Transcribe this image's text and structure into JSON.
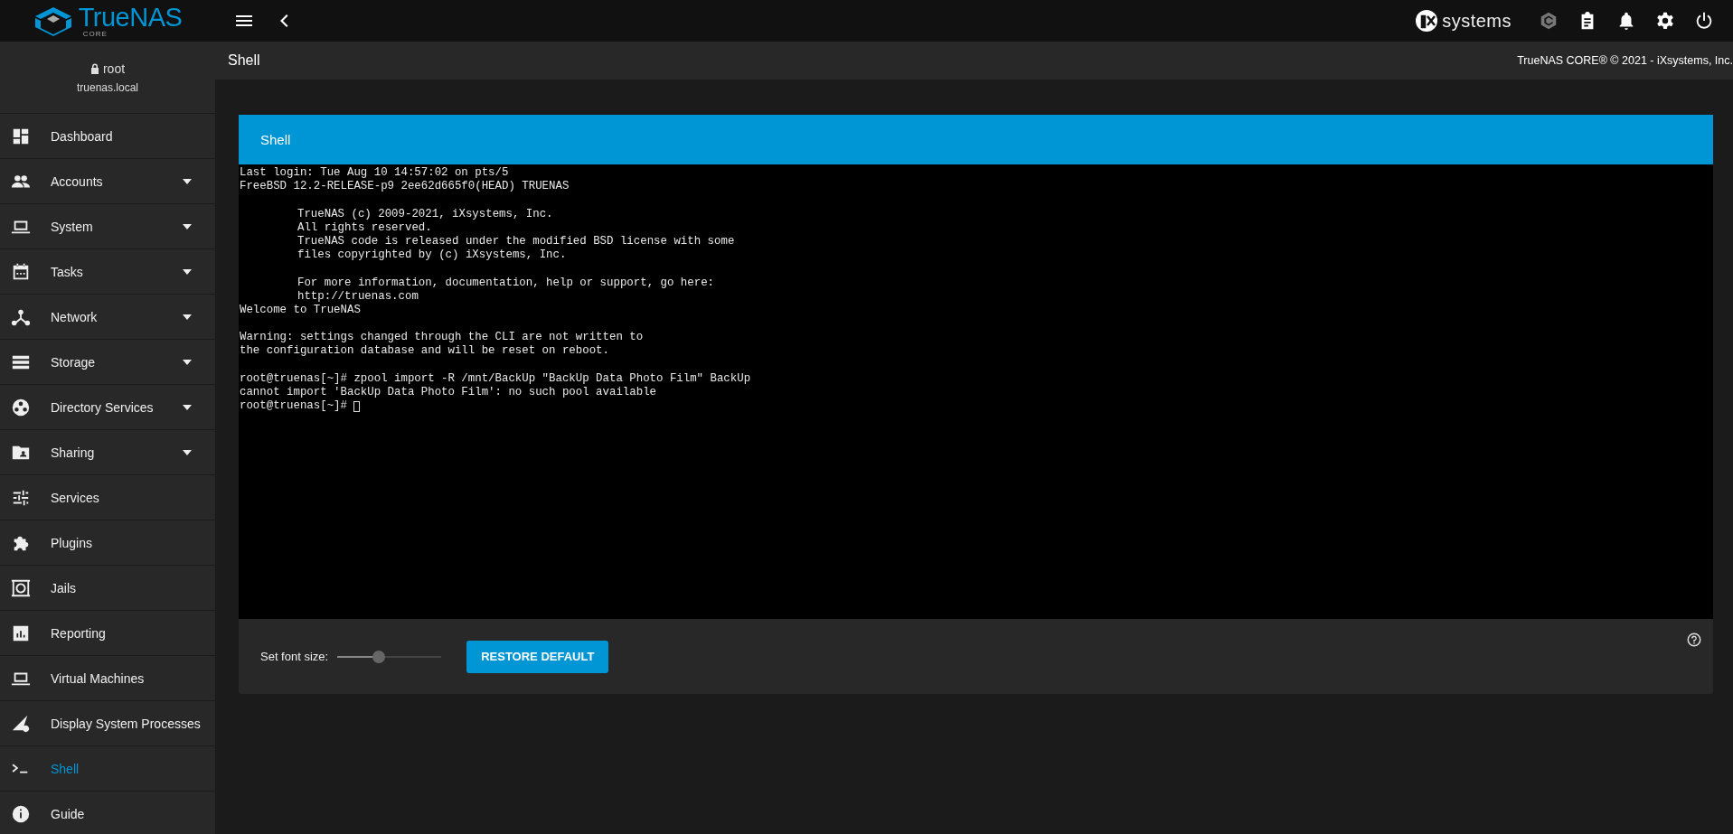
{
  "topbar": {
    "logo_text": "TrueNAS",
    "logo_sub": "CORE",
    "vendor_text": "systems"
  },
  "user": {
    "name": "root",
    "host": "truenas.local"
  },
  "sidebar": {
    "items": [
      {
        "label": "Dashboard",
        "has_submenu": false,
        "selected": false
      },
      {
        "label": "Accounts",
        "has_submenu": true,
        "selected": false
      },
      {
        "label": "System",
        "has_submenu": true,
        "selected": false
      },
      {
        "label": "Tasks",
        "has_submenu": true,
        "selected": false
      },
      {
        "label": "Network",
        "has_submenu": true,
        "selected": false
      },
      {
        "label": "Storage",
        "has_submenu": true,
        "selected": false
      },
      {
        "label": "Directory Services",
        "has_submenu": true,
        "selected": false
      },
      {
        "label": "Sharing",
        "has_submenu": true,
        "selected": false
      },
      {
        "label": "Services",
        "has_submenu": false,
        "selected": false
      },
      {
        "label": "Plugins",
        "has_submenu": false,
        "selected": false
      },
      {
        "label": "Jails",
        "has_submenu": false,
        "selected": false
      },
      {
        "label": "Reporting",
        "has_submenu": false,
        "selected": false
      },
      {
        "label": "Virtual Machines",
        "has_submenu": false,
        "selected": false
      },
      {
        "label": "Display System Processes",
        "has_submenu": false,
        "selected": false
      },
      {
        "label": "Shell",
        "has_submenu": false,
        "selected": true
      },
      {
        "label": "Guide",
        "has_submenu": false,
        "selected": false
      }
    ]
  },
  "page": {
    "title": "Shell",
    "copyright": "TrueNAS CORE® © 2021 - iXsystems, Inc."
  },
  "card": {
    "title": "Shell",
    "terminal": {
      "blocks": [
        [
          {
            "text": "Last login: Tue Aug 10 14:57:02 on pts/5",
            "indented": false
          },
          {
            "text": "FreeBSD 12.2-RELEASE-p9 2ee62d665f0(HEAD) TRUENAS",
            "indented": false
          }
        ],
        [
          {
            "text": "TrueNAS (c) 2009-2021, iXsystems, Inc.",
            "indented": true
          },
          {
            "text": "All rights reserved.",
            "indented": true
          },
          {
            "text": "TrueNAS code is released under the modified BSD license with some",
            "indented": true
          },
          {
            "text": "files copyrighted by (c) iXsystems, Inc.",
            "indented": true
          }
        ],
        [
          {
            "text": "For more information, documentation, help or support, go here:",
            "indented": true
          },
          {
            "text": "http://truenas.com",
            "indented": true
          },
          {
            "text": "Welcome to TrueNAS",
            "indented": false
          }
        ],
        [
          {
            "text": "Warning: settings changed through the CLI are not written to",
            "indented": false
          },
          {
            "text": "the configuration database and will be reset on reboot.",
            "indented": false
          }
        ],
        [
          {
            "text": "root@truenas[~]# zpool import -R /mnt/BackUp \"BackUp Data Photo Film\" BackUp",
            "indented": false
          },
          {
            "text": "cannot import 'BackUp Data Photo Film': no such pool available",
            "indented": false
          },
          {
            "text": "root@truenas[~]#",
            "indented": false,
            "cursor": true
          }
        ]
      ]
    },
    "font_size": {
      "label": "Set font size:",
      "level": 0.4
    },
    "restore_button": "RESTORE DEFAULT"
  }
}
